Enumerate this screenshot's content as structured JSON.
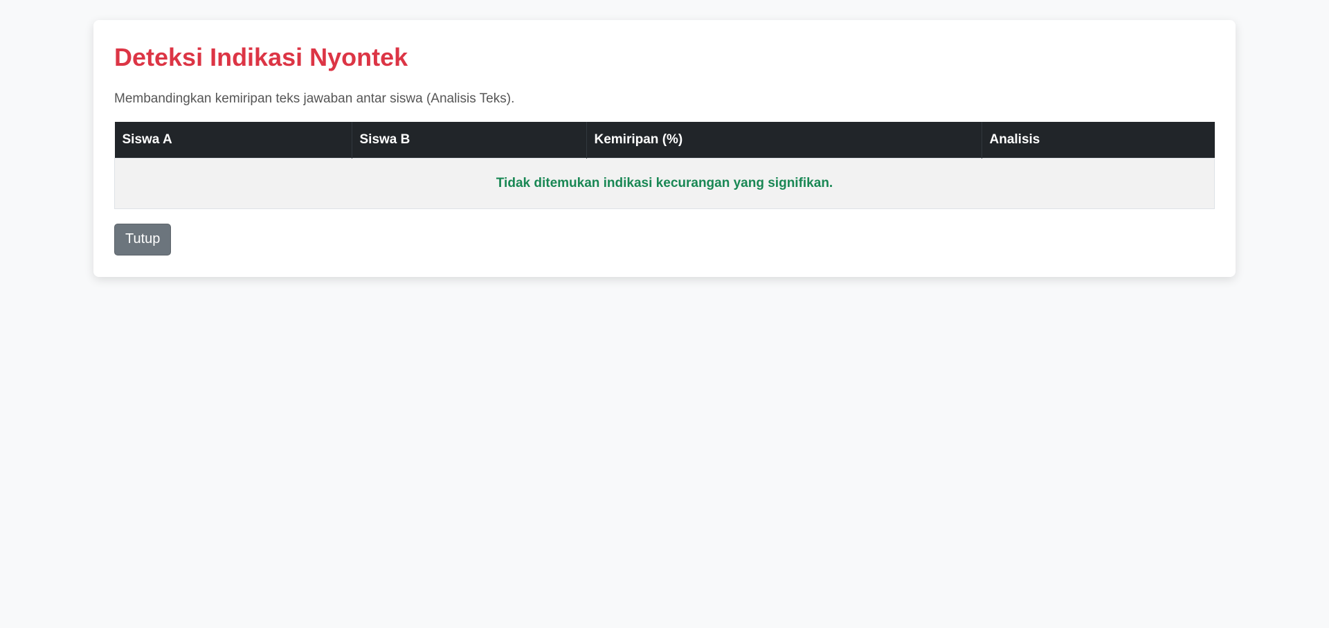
{
  "page": {
    "title": "Deteksi Indikasi Nyontek",
    "subtitle": "Membandingkan kemiripan teks jawaban antar siswa (Analisis Teks)."
  },
  "table": {
    "columns": [
      "Siswa A",
      "Siswa B",
      "Kemiripan (%)",
      "Analisis"
    ],
    "empty_message": "Tidak ditemukan indikasi kecurangan yang signifikan."
  },
  "actions": {
    "close_label": "Tutup"
  },
  "colors": {
    "title": "#dc3545",
    "header_bg": "#212529",
    "success_text": "#198754",
    "button_bg": "#6c757d"
  }
}
